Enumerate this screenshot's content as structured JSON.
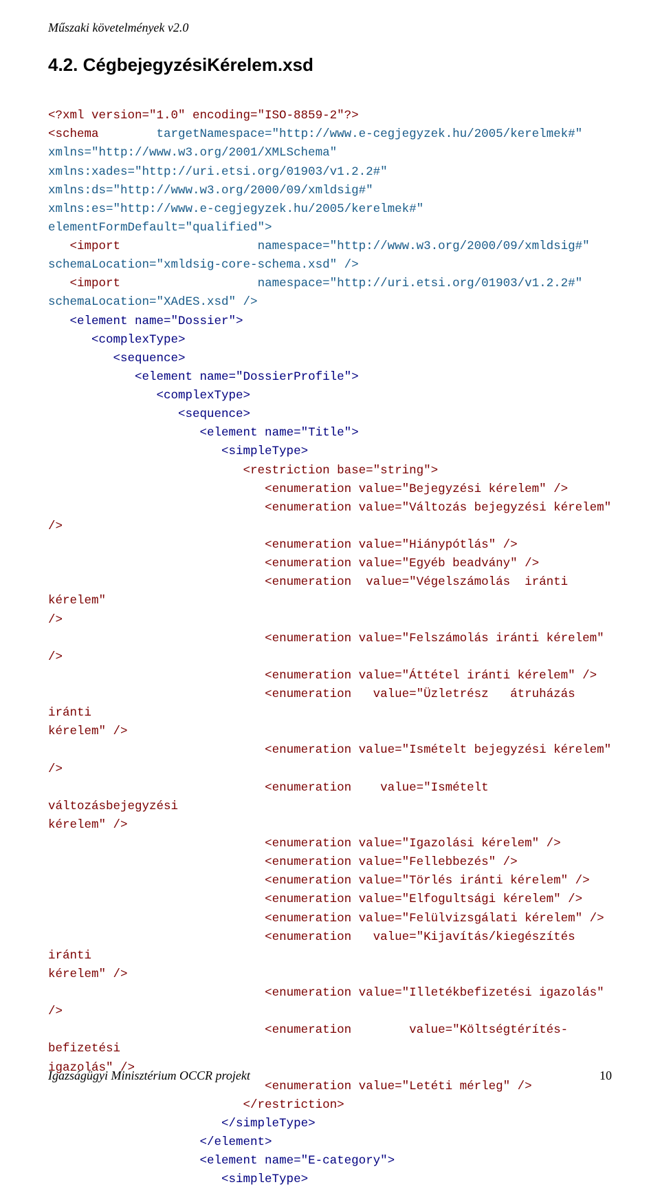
{
  "header": "Műszaki követelmények v2.0",
  "section_number": "4.2.",
  "section_title": "CégbejegyzésiKérelem.xsd",
  "footer_org": "Igazságügyi Minisztérium OCCR projekt",
  "footer_page": "10",
  "xml_decl": "<?xml version=\"1.0\" encoding=\"ISO-8859-2\"?>",
  "schema_open": "<schema",
  "schema_attrs": {
    "targetNamespace": "targetNamespace=\"http://www.e-cegjegyzek.hu/2005/kerelmek#\"",
    "xmlns": "xmlns=\"http://www.w3.org/2001/XMLSchema\"",
    "xades": "xmlns:xades=\"http://uri.etsi.org/01903/v1.2.2#\"",
    "ds": "xmlns:ds=\"http://www.w3.org/2000/09/xmldsig#\"",
    "es": "xmlns:es=\"http://www.e-cegjegyzek.hu/2005/kerelmek#\"",
    "efd": "elementFormDefault=\"qualified\">"
  },
  "import1_a": "   <import",
  "import1_b": "namespace=\"http://www.w3.org/2000/09/xmldsig#\"",
  "import1_c": "schemaLocation=\"xmldsig-core-schema.xsd\" />",
  "import2_a": "   <import",
  "import2_b": "namespace=\"http://uri.etsi.org/01903/v1.2.2#\"",
  "import2_c": "schemaLocation=\"XAdES.xsd\" />",
  "el_dossier": "   <element name=\"Dossier\">",
  "ct1": "      <complexType>",
  "seq1": "         <sequence>",
  "el_dp": "            <element name=\"DossierProfile\">",
  "ct2": "               <complexType>",
  "seq2": "                  <sequence>",
  "el_title": "                     <element name=\"Title\">",
  "st1": "                        <simpleType>",
  "restr": "                           <restriction base=\"string\">",
  "enum_vals": [
    "Bejegyzési kérelem",
    "Változás bejegyzési kérelem",
    "Hiánypótlás",
    "Egyéb beadvány",
    "Végelszámolás iránti kérelem",
    "Felszámolás iránti kérelem",
    "Áttétel iránti kérelem",
    "Üzletrész átruházás iránti kérelem",
    "Ismételt bejegyzési kérelem",
    "Ismételt változásbejegyzési kérelem",
    "Igazolási kérelem",
    "Fellebbezés",
    "Törlés iránti kérelem",
    "Elfogultsági kérelem",
    "Felülvizsgálati kérelem",
    "Kijavítás/kiegészítés iránti kérelem",
    "Illetékbefizetési igazolás",
    "Költségtérítés-befizetési igazolás",
    "Letéti mérleg"
  ],
  "enum_std_lines": {
    "0": "                              <enumeration value=\"Bejegyzési kérelem\" />",
    "1": "                              <enumeration value=\"Változás bejegyzési kérelem\" />",
    "2": "                              <enumeration value=\"Hiánypótlás\" />",
    "3": "                              <enumeration value=\"Egyéb beadvány\" />",
    "5": "                              <enumeration value=\"Felszámolás iránti kérelem\" />",
    "6": "                              <enumeration value=\"Áttétel iránti kérelem\" />",
    "8": "                              <enumeration value=\"Ismételt bejegyzési kérelem\" />",
    "10": "                              <enumeration value=\"Igazolási kérelem\" />",
    "11": "                              <enumeration value=\"Fellebbezés\" />",
    "12": "                              <enumeration value=\"Törlés iránti kérelem\" />",
    "13": "                              <enumeration value=\"Elfogultsági kérelem\" />",
    "14": "                              <enumeration value=\"Felülvizsgálati kérelem\" />",
    "16": "                              <enumeration value=\"Illetékbefizetési igazolás\" />",
    "18": "                              <enumeration value=\"Letéti mérleg\" />"
  },
  "enum_just": {
    "4a": "                              <enumeration",
    "4b": "value=\"Végelszámolás  iránti  kérelem\"",
    "4c": "/>",
    "7a": "                              <enumeration",
    "7b": "value=\"Üzletrész   átruházás   iránti",
    "7c": "kérelem\" />",
    "9a": "                              <enumeration",
    "9b": "value=\"Ismételt   változásbejegyzési",
    "9c": "kérelem\" />",
    "15a": "                              <enumeration",
    "15b": "value=\"Kijavítás/kiegészítés   iránti",
    "15c": "kérelem\" />",
    "17a": "                              <enumeration",
    "17b": "value=\"Költségtérítés-befizetési",
    "17c": "igazolás\" />"
  },
  "restr_close": "                           </restriction>",
  "st_close": "                        </simpleType>",
  "el_close": "                     </element>",
  "el_ecat": "                     <element name=\"E-category\">",
  "st2": "                        <simpleType>"
}
